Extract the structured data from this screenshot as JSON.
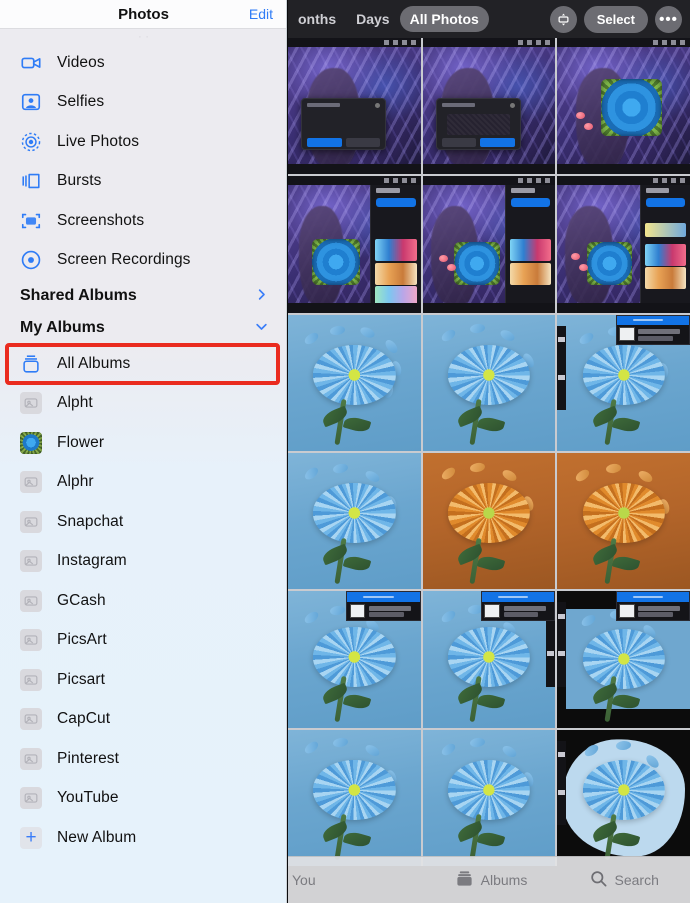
{
  "app": {
    "name": "Photos"
  },
  "sidebar": {
    "header": {
      "title": "Photos",
      "edit_label": "Edit"
    },
    "media_types": [
      {
        "label": "Videos",
        "icon": "video-camera-icon"
      },
      {
        "label": "Selfies",
        "icon": "portrait-person-icon"
      },
      {
        "label": "Live Photos",
        "icon": "live-photo-icon"
      },
      {
        "label": "Bursts",
        "icon": "burst-stack-icon"
      },
      {
        "label": "Screenshots",
        "icon": "screenshot-frame-icon"
      },
      {
        "label": "Screen Recordings",
        "icon": "screen-recording-icon"
      }
    ],
    "sections": [
      {
        "label": "Shared Albums",
        "chevron": "›",
        "chevron_name": "chevron-right-icon"
      },
      {
        "label": "My Albums",
        "chevron": "⌄",
        "chevron_name": "chevron-down-icon"
      }
    ],
    "albums": [
      {
        "label": "All Albums",
        "icon": "albums-stack-icon",
        "highlighted": true
      },
      {
        "label": "Alpht",
        "icon": "album-placeholder-icon"
      },
      {
        "label": "Flower",
        "icon": "album-thumbnail-flower"
      },
      {
        "label": "Alphr",
        "icon": "album-placeholder-icon"
      },
      {
        "label": "Snapchat",
        "icon": "album-placeholder-icon"
      },
      {
        "label": "Instagram",
        "icon": "album-placeholder-icon"
      },
      {
        "label": "GCash",
        "icon": "album-placeholder-icon"
      },
      {
        "label": "PicsArt",
        "icon": "album-placeholder-icon"
      },
      {
        "label": "Picsart",
        "icon": "album-placeholder-icon"
      },
      {
        "label": "CapCut",
        "icon": "album-placeholder-icon"
      },
      {
        "label": "Pinterest",
        "icon": "album-placeholder-icon"
      },
      {
        "label": "YouTube",
        "icon": "album-placeholder-icon"
      },
      {
        "label": "New Album",
        "icon": "plus-icon"
      }
    ],
    "highlight_color": "#ea2b1f"
  },
  "toolbar": {
    "segments": [
      {
        "label": "onths",
        "active": false
      },
      {
        "label": "Days",
        "active": false
      },
      {
        "label": "All Photos",
        "active": true
      }
    ],
    "zoom_icon": "zoom-resize-icon",
    "select_label": "Select",
    "more_label": "•••"
  },
  "tabbar": {
    "tabs": [
      {
        "label": "You",
        "icon": "person-icon"
      },
      {
        "label": "Albums",
        "icon": "albums-icon"
      },
      {
        "label": "Search",
        "icon": "search-icon"
      }
    ]
  },
  "grid": {
    "rows": 6,
    "columns": 3,
    "cells": [
      {
        "kind": "art",
        "variant": "reference-dialog"
      },
      {
        "kind": "art",
        "variant": "import-dialog"
      },
      {
        "kind": "art",
        "variant": "rose-canvas"
      },
      {
        "kind": "art",
        "variant": "palette-panel-1"
      },
      {
        "kind": "art",
        "variant": "palette-panel-2"
      },
      {
        "kind": "art",
        "variant": "palette-panel-3"
      },
      {
        "kind": "flower",
        "variant": "plain-blue"
      },
      {
        "kind": "flower",
        "variant": "plain-blue"
      },
      {
        "kind": "flower",
        "variant": "blue-with-layers-panel"
      },
      {
        "kind": "flower",
        "variant": "plain-blue"
      },
      {
        "kind": "flower",
        "variant": "orange-tint"
      },
      {
        "kind": "flower",
        "variant": "orange-tint"
      },
      {
        "kind": "flower",
        "variant": "blue-with-panel"
      },
      {
        "kind": "flower",
        "variant": "blue-with-panel"
      },
      {
        "kind": "flower",
        "variant": "dark-bg-panel"
      },
      {
        "kind": "flower",
        "variant": "plain-blue"
      },
      {
        "kind": "flower",
        "variant": "plain-blue"
      },
      {
        "kind": "flower",
        "variant": "black-cutout"
      }
    ]
  }
}
